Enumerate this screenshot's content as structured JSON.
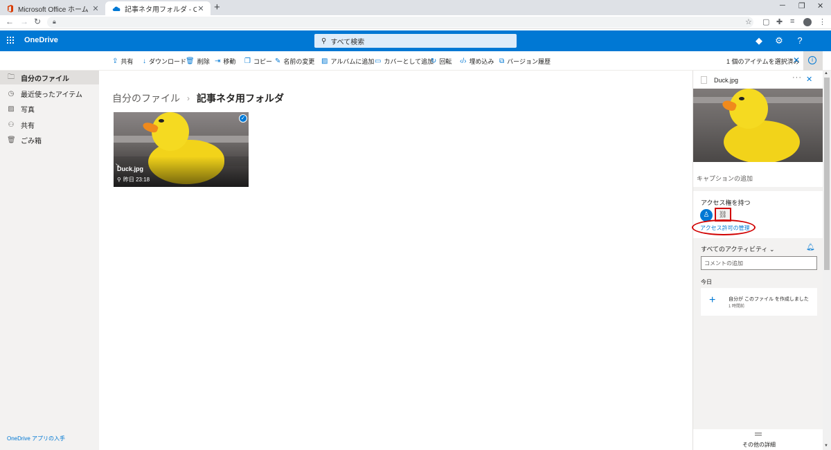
{
  "browser": {
    "tabs": [
      {
        "title": "Microsoft Office ホーム",
        "active": false
      },
      {
        "title": "記事ネタ用フォルダ - OneDrive",
        "active": true
      }
    ],
    "new_tab": "+",
    "close_glyph": "✕",
    "window_controls": [
      "─",
      "❐",
      "✕"
    ],
    "url": ""
  },
  "suite_bar": {
    "app_name": "OneDrive",
    "search_placeholder": "すべて検索",
    "icons": [
      "diamond-icon",
      "gear-icon",
      "help-icon"
    ],
    "brand_color": "#0078d4"
  },
  "command_bar": {
    "commands": [
      {
        "label": "共有",
        "icon": "share-icon"
      },
      {
        "label": "ダウンロード",
        "icon": "download-icon"
      },
      {
        "label": "削除",
        "icon": "trash-icon"
      },
      {
        "label": "移動",
        "icon": "move-icon"
      },
      {
        "label": "コピー",
        "icon": "copy-icon"
      },
      {
        "label": "名前の変更",
        "icon": "rename-icon"
      },
      {
        "label": "アルバムに追加",
        "icon": "album-icon"
      },
      {
        "label": "カバーとして追加",
        "icon": "cover-icon"
      },
      {
        "label": "回転",
        "icon": "rotate-icon"
      },
      {
        "label": "埋め込み",
        "icon": "embed-icon"
      },
      {
        "label": "バージョン履歴",
        "icon": "history-icon"
      }
    ],
    "selection_status": "1 個のアイテムを選択済み"
  },
  "left_nav": {
    "items": [
      {
        "label": "自分のファイル",
        "icon": "folder-icon",
        "selected": true
      },
      {
        "label": "最近使ったアイテム",
        "icon": "clock-icon",
        "selected": false
      },
      {
        "label": "写真",
        "icon": "photo-icon",
        "selected": false
      },
      {
        "label": "共有",
        "icon": "shared-icon",
        "selected": false
      },
      {
        "label": "ごみ箱",
        "icon": "recycle-icon",
        "selected": false
      }
    ],
    "get_app": "OneDrive アプリの入手"
  },
  "main": {
    "breadcrumb": {
      "root": "自分のファイル",
      "current": "記事ネタ用フォルダ"
    },
    "files": [
      {
        "name": "Duck.jpg",
        "modified": "昨日 23:18",
        "selected": true
      }
    ]
  },
  "details_pane": {
    "filename": "Duck.jpg",
    "more": "···",
    "caption_placeholder": "キャプションの追加",
    "access_title": "アクセス権を持つ",
    "manage_access": "アクセス許可の管理",
    "activity_title": "すべてのアクティビティ",
    "comment_placeholder": "コメントの追加",
    "today_label": "今日",
    "activity": {
      "text": "自分が このファイル を作成しました",
      "time": "1 時間前"
    },
    "more_details": "その他の詳細",
    "annotation_color": "#d10000"
  }
}
